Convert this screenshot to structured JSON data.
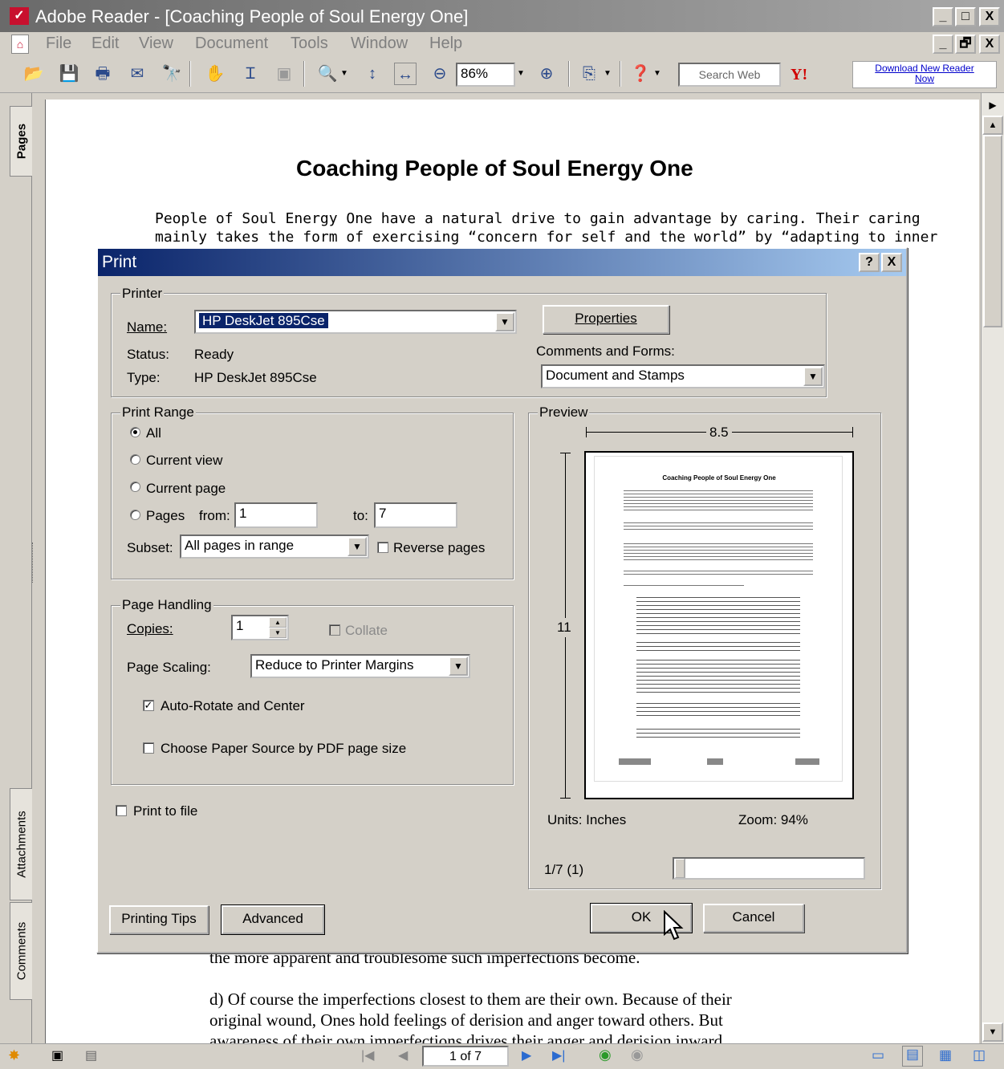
{
  "window": {
    "title": "Adobe Reader - [Coaching People of Soul Energy One]",
    "controls": [
      "_",
      "□",
      "X"
    ],
    "doc_controls": [
      "_",
      "🗗",
      "X"
    ]
  },
  "menu": [
    "File",
    "Edit",
    "View",
    "Document",
    "Tools",
    "Window",
    "Help"
  ],
  "toolbar": {
    "zoom_value": "86%",
    "search_placeholder": "Search Web",
    "yahoo_label": "Y!",
    "download_link": "Download New Reader Now"
  },
  "left_tabs": {
    "pages": "Pages",
    "attachments": "Attachments",
    "comments": "Comments"
  },
  "document": {
    "title": "Coaching People of Soul Energy One",
    "para1_line1": "People of Soul Energy One have a natural drive to gain advantage by caring.  Their caring",
    "para1_line2": "mainly takes the form of exercising “concern for self and the world” by “adapting to inner",
    "tail_line1": "the more apparent and troublesome such imperfections become.",
    "tail_line2": "d) Of course the imperfections closest to them are their own.  Because of their",
    "tail_line3": "original wound, Ones hold feelings of derision and anger toward others.  But",
    "tail_line4": "awareness of their own imperfections drives their anger and derision inward"
  },
  "print_dialog": {
    "title": "Print",
    "help_label": "?",
    "close_label": "X",
    "printer": {
      "legend": "Printer",
      "name_label": "Name:",
      "name_value": "HP DeskJet 895Cse",
      "status_label": "Status:",
      "status_value": "Ready",
      "type_label": "Type:",
      "type_value": "HP DeskJet 895Cse",
      "properties_button": "Properties",
      "comments_forms_label": "Comments and Forms:",
      "comments_forms_value": "Document and Stamps"
    },
    "print_range": {
      "legend": "Print Range",
      "all": "All",
      "current_view": "Current view",
      "current_page": "Current page",
      "pages": "Pages",
      "from_label": "from:",
      "from_value": "1",
      "to_label": "to:",
      "to_value": "7",
      "subset_label": "Subset:",
      "subset_value": "All pages in range",
      "reverse_pages": "Reverse pages"
    },
    "page_handling": {
      "legend": "Page Handling",
      "copies_label": "Copies:",
      "copies_value": "1",
      "collate": "Collate",
      "scaling_label": "Page Scaling:",
      "scaling_value": "Reduce to Printer Margins",
      "auto_rotate": "Auto-Rotate and Center",
      "paper_source": "Choose Paper Source by PDF page size"
    },
    "print_to_file": "Print to file",
    "preview": {
      "legend": "Preview",
      "width": "8.5",
      "height": "11",
      "units": "Units: Inches",
      "zoom": "Zoom:  94%",
      "page_indicator": "1/7 (1)",
      "thumb_title": "Coaching People of Soul Energy One"
    },
    "buttons": {
      "printing_tips": "Printing Tips",
      "advanced": "Advanced",
      "ok": "OK",
      "cancel": "Cancel"
    }
  },
  "statusbar": {
    "page_indicator": "1 of 7"
  }
}
